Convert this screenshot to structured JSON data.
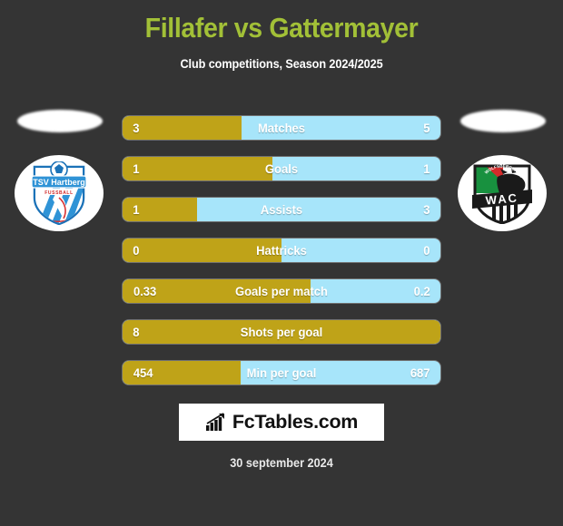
{
  "header": {
    "title": "Fillafer vs Gattermayer",
    "subtitle": "Club competitions, Season 2024/2025",
    "title_color": "#a2c037",
    "subtitle_color": "#ffffff"
  },
  "teams": {
    "home": {
      "crest_name": "tsv-hartberg-crest",
      "crest_line1": "TSV Hartberg",
      "crest_line2": "FUSSBALL"
    },
    "away": {
      "crest_name": "wac-crest",
      "crest_line1": "WAC",
      "crest_line2": "WOLFSBERGER AC"
    }
  },
  "colors": {
    "background": "#343434",
    "home_bar": "#bfa318",
    "away_bar": "#a7e5fa",
    "bar_text": "#ffffff"
  },
  "chart_data": {
    "type": "bar",
    "title": "Fillafer vs Gattermayer",
    "subtitle": "Club competitions, Season 2024/2025",
    "orientation": "horizontal-diverging",
    "series": [
      {
        "name": "Fillafer",
        "color": "#bfa318",
        "values": [
          "3",
          "1",
          "1",
          "0",
          "0.33",
          "8",
          "454"
        ]
      },
      {
        "name": "Gattermayer",
        "color": "#a7e5fa",
        "values": [
          "5",
          "1",
          "3",
          "0",
          "0.2",
          "",
          "687"
        ]
      }
    ],
    "categories": [
      "Matches",
      "Goals",
      "Assists",
      "Hattricks",
      "Goals per match",
      "Shots per goal",
      "Min per goal"
    ],
    "rows": [
      {
        "label": "Matches",
        "home": "3",
        "away": "5",
        "home_pct": 37.5,
        "full": false
      },
      {
        "label": "Goals",
        "home": "1",
        "away": "1",
        "home_pct": 47,
        "full": false
      },
      {
        "label": "Assists",
        "home": "1",
        "away": "3",
        "home_pct": 23.5,
        "full": false
      },
      {
        "label": "Hattricks",
        "home": "0",
        "away": "0",
        "home_pct": 50,
        "full": false
      },
      {
        "label": "Goals per match",
        "home": "0.33",
        "away": "0.2",
        "home_pct": 59,
        "full": false
      },
      {
        "label": "Shots per goal",
        "home": "8",
        "away": "",
        "home_pct": 100,
        "full": true
      },
      {
        "label": "Min per goal",
        "home": "454",
        "away": "687",
        "home_pct": 37,
        "full": false
      }
    ]
  },
  "footer": {
    "brand": "FcTables.com",
    "brand_icon": "bar-chart-icon",
    "date": "30 september 2024"
  }
}
